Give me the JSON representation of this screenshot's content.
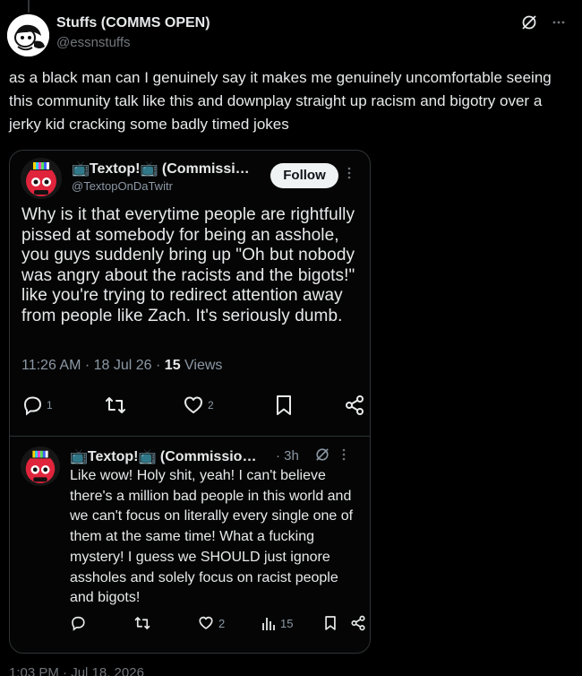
{
  "post": {
    "author_name": "Stuffs (COMMS OPEN)",
    "author_handle": "@essnstuffs",
    "text": "as a black man can I genuinely say it makes me genuinely uncomfortable seeing this community talk like this and downplay straight up racism and bigotry over a jerky kid cracking some badly timed jokes",
    "icons": [
      "grok-icon",
      "more-icon"
    ],
    "bottom_meta": "1:03 PM · Jul 18, 2026"
  },
  "quoted_post": {
    "author_name": "📺Textop!📺 (Commissi…",
    "author_handle": "@TextopOnDaTwitr",
    "follow_label": "Follow",
    "text": "Why is it that everytime people are rightfully pissed at somebody for being an asshole, you guys suddenly bring up \"Oh but nobody was angry about the racists and the bigots!\" like you're trying to redirect attention away from people like Zach. It's seriously dumb.",
    "meta_time": "11:26 AM · 18 Jul 26 · ",
    "meta_views_count": "15",
    "meta_views_label": " Views",
    "actions": {
      "reply_count": "1",
      "repost_count": "",
      "like_count": "2"
    }
  },
  "reply": {
    "author_name": "📺Textop!📺 (Commissio…",
    "time": "· 3h",
    "text": "Like wow! Holy shit, yeah! I can't believe there's a million bad people in this world and we can't focus on literally every single one of them at the same time! What a fucking mystery! I guess we SHOULD just ignore assholes and solely focus on racist people and bigots!",
    "actions": {
      "reply_count": "",
      "repost_count": "",
      "like_count": "2",
      "views_count": "15"
    }
  },
  "colors": {
    "background": "#000000",
    "text": "#e7e9ea",
    "secondary": "#71767b",
    "border": "#2f3336",
    "follow_bg": "#eff3f4"
  }
}
